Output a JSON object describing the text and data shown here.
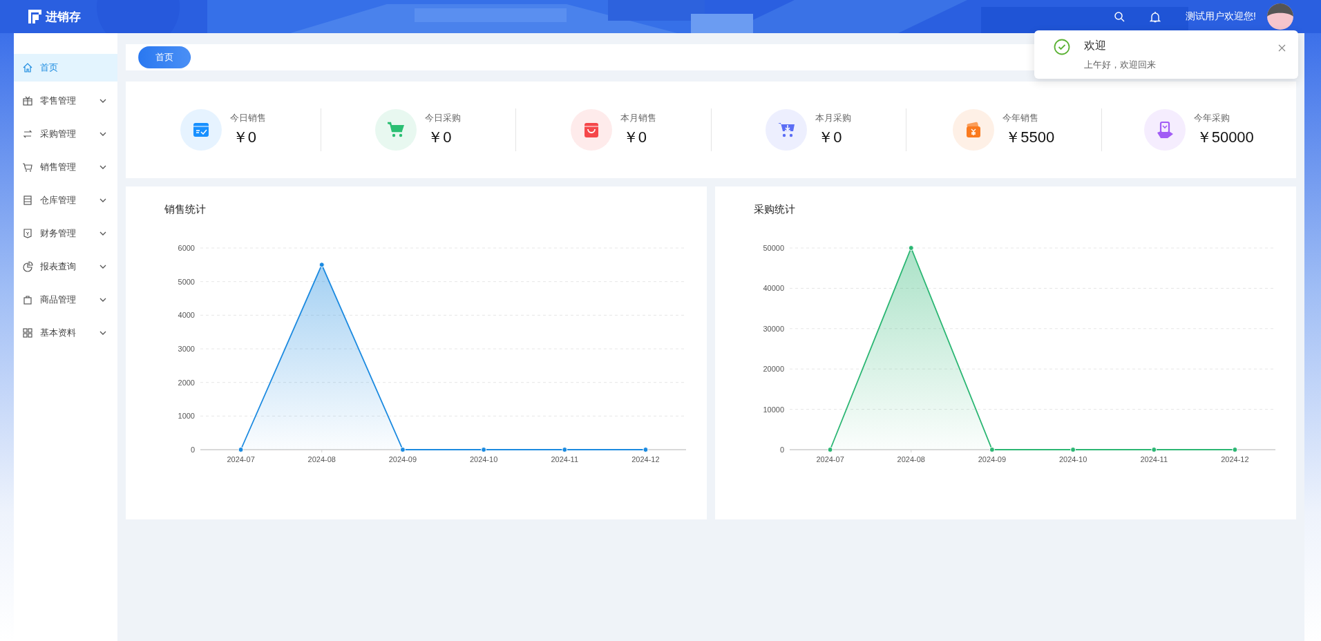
{
  "header": {
    "logo_text": "进销存",
    "user_greeting": "测试用户欢迎您!"
  },
  "sidebar": {
    "items": [
      {
        "label": "首页",
        "kind": "link",
        "selected": true
      },
      {
        "label": "零售管理",
        "kind": "submenu",
        "selected": false
      },
      {
        "label": "采购管理",
        "kind": "submenu",
        "selected": false
      },
      {
        "label": "销售管理",
        "kind": "submenu",
        "selected": false
      },
      {
        "label": "仓库管理",
        "kind": "submenu",
        "selected": false
      },
      {
        "label": "财务管理",
        "kind": "submenu",
        "selected": false
      },
      {
        "label": "报表查询",
        "kind": "submenu",
        "selected": false
      },
      {
        "label": "商品管理",
        "kind": "submenu",
        "selected": false
      },
      {
        "label": "基本资料",
        "kind": "submenu",
        "selected": false
      }
    ]
  },
  "tabs": [
    {
      "label": "首页",
      "selected": true
    }
  ],
  "stats": [
    {
      "label": "今日销售",
      "value": "￥0",
      "color": "#1890ff"
    },
    {
      "label": "今日采购",
      "value": "￥0",
      "color": "#2bbf73"
    },
    {
      "label": "本月销售",
      "value": "￥0",
      "color": "#f5474a"
    },
    {
      "label": "本月采购",
      "value": "￥0",
      "color": "#5b6ef5"
    },
    {
      "label": "今年销售",
      "value": "￥5500",
      "color": "#fa7a1e"
    },
    {
      "label": "今年采购",
      "value": "￥50000",
      "color": "#a15cf5"
    }
  ],
  "charts": [
    {
      "title": "销售统计",
      "chart_data": {
        "type": "area",
        "categories": [
          "2024-07",
          "2024-08",
          "2024-09",
          "2024-10",
          "2024-11",
          "2024-12"
        ],
        "series": [
          {
            "color": "#1b8ae0",
            "values": [
              0,
              5500,
              0,
              0,
              0,
              0
            ]
          }
        ],
        "grid": true,
        "ylim": [
          0,
          6000
        ],
        "yticks": [
          0,
          1000,
          2000,
          3000,
          4000,
          5000,
          6000
        ]
      }
    },
    {
      "title": "采购统计",
      "chart_data": {
        "type": "area",
        "categories": [
          "2024-07",
          "2024-08",
          "2024-09",
          "2024-10",
          "2024-11",
          "2024-12"
        ],
        "series": [
          {
            "color": "#2bb673",
            "values": [
              0,
              50000,
              0,
              0,
              0,
              0
            ]
          }
        ],
        "grid": true,
        "ylim": [
          0,
          50000
        ],
        "yticks": [
          0,
          10000,
          20000,
          30000,
          40000,
          50000
        ]
      }
    }
  ],
  "notification": {
    "title": "欢迎",
    "message": "上午好，欢迎回来"
  }
}
